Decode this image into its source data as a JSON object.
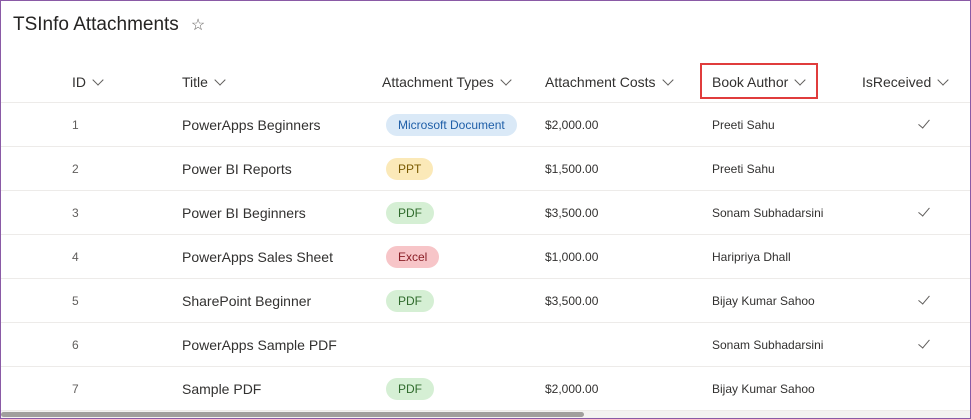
{
  "app": {
    "title": "TSInfo Attachments",
    "favorite_icon": "star-outline-icon"
  },
  "columns": [
    {
      "key": "id",
      "label": "ID"
    },
    {
      "key": "title",
      "label": "Title"
    },
    {
      "key": "types",
      "label": "Attachment Types"
    },
    {
      "key": "costs",
      "label": "Attachment Costs"
    },
    {
      "key": "author",
      "label": "Book Author"
    },
    {
      "key": "received",
      "label": "IsReceived"
    }
  ],
  "rows": [
    {
      "id": "1",
      "title": "PowerApps Beginners",
      "type": "Microsoft Document",
      "type_bg": "#dae9f7",
      "type_fg": "#1f5fa8",
      "cost": "$2,000.00",
      "author": "Preeti Sahu",
      "received": true
    },
    {
      "id": "2",
      "title": "Power BI Reports",
      "type": "PPT",
      "type_bg": "#fbe9b8",
      "type_fg": "#7a5a00",
      "cost": "$1,500.00",
      "author": "Preeti Sahu",
      "received": false
    },
    {
      "id": "3",
      "title": "Power BI Beginners",
      "type": "PDF",
      "type_bg": "#d5efd4",
      "type_fg": "#2f6b2c",
      "cost": "$3,500.00",
      "author": "Sonam Subhadarsini",
      "received": true
    },
    {
      "id": "4",
      "title": "PowerApps Sales Sheet",
      "type": "Excel",
      "type_bg": "#f7c5c8",
      "type_fg": "#8a1f27",
      "cost": "$1,000.00",
      "author": "Haripriya Dhall",
      "received": false
    },
    {
      "id": "5",
      "title": "SharePoint Beginner",
      "type": "PDF",
      "type_bg": "#d5efd4",
      "type_fg": "#2f6b2c",
      "cost": "$3,500.00",
      "author": "Bijay Kumar Sahoo",
      "received": true
    },
    {
      "id": "6",
      "title": "PowerApps Sample PDF",
      "type": "",
      "type_bg": "",
      "type_fg": "",
      "cost": "",
      "author": "Sonam Subhadarsini",
      "received": true
    },
    {
      "id": "7",
      "title": "Sample PDF",
      "type": "PDF",
      "type_bg": "#d5efd4",
      "type_fg": "#2f6b2c",
      "cost": "$2,000.00",
      "author": "Bijay Kumar Sahoo",
      "received": false
    }
  ],
  "colors": {
    "highlight": "#e03c3c",
    "frame": "#8a5aa6"
  }
}
